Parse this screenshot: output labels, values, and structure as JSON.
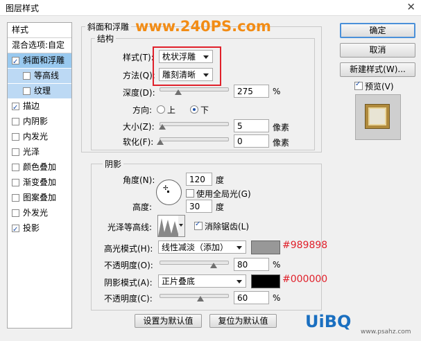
{
  "window": {
    "title": "图层样式",
    "close_glyph": "✕"
  },
  "left_panel": {
    "header": "样式",
    "blend_options": "混合选项:自定",
    "items": [
      {
        "label": "斜面和浮雕",
        "checked": true,
        "state": "selected"
      },
      {
        "label": "等高线",
        "checked": false,
        "state": "sub"
      },
      {
        "label": "纹理",
        "checked": false,
        "state": "sub"
      },
      {
        "label": "描边",
        "checked": true,
        "state": "normal"
      },
      {
        "label": "内阴影",
        "checked": false,
        "state": "normal"
      },
      {
        "label": "内发光",
        "checked": false,
        "state": "normal"
      },
      {
        "label": "光泽",
        "checked": false,
        "state": "normal"
      },
      {
        "label": "颜色叠加",
        "checked": false,
        "state": "normal"
      },
      {
        "label": "渐变叠加",
        "checked": false,
        "state": "normal"
      },
      {
        "label": "图案叠加",
        "checked": false,
        "state": "normal"
      },
      {
        "label": "外发光",
        "checked": false,
        "state": "normal"
      },
      {
        "label": "投影",
        "checked": true,
        "state": "normal"
      }
    ]
  },
  "bevel": {
    "group_label": "斜面和浮雕",
    "structure_label": "结构",
    "style_label": "样式(T):",
    "style_value": "枕状浮雕",
    "technique_label": "方法(Q):",
    "technique_value": "雕刻清晰",
    "depth_label": "深度(D):",
    "depth_value": "275",
    "depth_unit": "%",
    "depth_fraction": 0.275,
    "direction_label": "方向:",
    "direction_up": "上",
    "direction_down": "下",
    "size_label": "大小(Z):",
    "size_value": "5",
    "size_unit": "像素",
    "soften_label": "软化(F):",
    "soften_value": "0",
    "soften_unit": "像素"
  },
  "shading": {
    "group_label": "阴影",
    "angle_label": "角度(N):",
    "angle_value": "120",
    "angle_unit": "度",
    "global_light_label": "使用全局光(G)",
    "altitude_label": "高度:",
    "altitude_value": "30",
    "altitude_unit": "度",
    "gloss_label": "光泽等高线:",
    "antialias_label": "消除锯齿(L)",
    "highlight_mode_label": "高光模式(H):",
    "highlight_mode_value": "线性减淡（添加）",
    "highlight_color": "#989898",
    "highlight_color_text": "#989898",
    "highlight_opacity_label": "不透明度(O):",
    "highlight_opacity_value": "80",
    "highlight_opacity_fraction": 0.8,
    "shadow_mode_label": "阴影模式(A):",
    "shadow_mode_value": "正片叠底",
    "shadow_color": "#000000",
    "shadow_color_text": "#000000",
    "shadow_opacity_label": "不透明度(C):",
    "shadow_opacity_value": "60",
    "shadow_opacity_fraction": 0.6,
    "percent": "%"
  },
  "bottom_buttons": {
    "make_default": "设置为默认值",
    "reset_default": "复位为默认值"
  },
  "right_panel": {
    "ok": "确定",
    "cancel": "取消",
    "new_style": "新建样式(W)...",
    "preview_label": "预览(V)"
  },
  "watermarks": {
    "top": "www.240PS.com",
    "bottom_brand": "UiBQ",
    "bottom_url": "www.psahz.com"
  }
}
